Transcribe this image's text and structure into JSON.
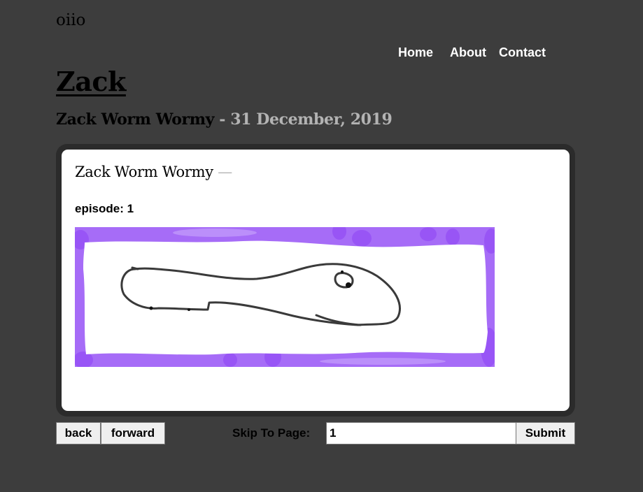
{
  "site": {
    "logo": "oiio"
  },
  "nav": {
    "items": [
      "Home",
      "About",
      "Contact"
    ]
  },
  "page": {
    "title": "Zack",
    "subtitle_name": "Zack Worm Wormy",
    "subtitle_separator": " - ",
    "subtitle_date": "31 December, 2019"
  },
  "post": {
    "title": "Zack Worm Wormy",
    "title_dash": " —",
    "episode": "episode: 1",
    "image_description": "hand-drawn worm on white with purple border",
    "colors": {
      "border_purple": "#9b5cf6",
      "ink": "#3a3a3a"
    }
  },
  "controls": {
    "back_label": "back",
    "forward_label": "forward",
    "skip_label": "Skip To Page:",
    "page_value": "1",
    "submit_label": "Submit"
  },
  "theme": {
    "background": "#3d3d3d",
    "frame": "#2b2b2b",
    "muted_text": "#b3b3b3"
  }
}
